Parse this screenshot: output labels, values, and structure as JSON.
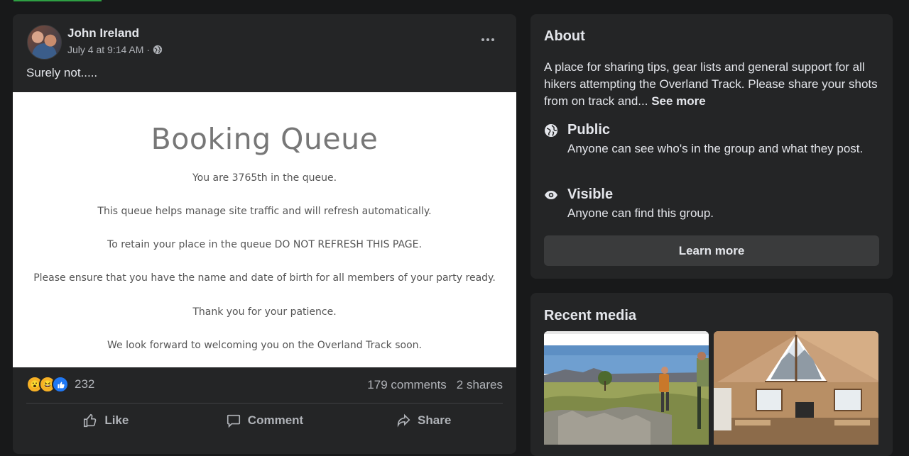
{
  "post": {
    "author": "John Ireland",
    "timestamp": "July 4 at 9:14 AM",
    "separator": "·",
    "audience_icon": "globe-icon",
    "text": "Surely not.....",
    "image": {
      "title": "Booking Queue",
      "lines": [
        "You are 3765th in the queue.",
        "This queue helps manage site traffic and will refresh automatically.",
        "To retain your place in the queue DO NOT REFRESH THIS PAGE.",
        "Please ensure that you have the name and date of birth for all members of your party ready.",
        "Thank you for your patience.",
        "We look forward to welcoming you on the Overland Track soon."
      ]
    },
    "reaction_count": "232",
    "reaction_icons": [
      "wow-icon",
      "haha-icon",
      "like-reaction-icon"
    ],
    "comments": "179 comments",
    "shares": "2 shares",
    "actions": {
      "like": "Like",
      "comment": "Comment",
      "share": "Share"
    }
  },
  "about": {
    "title": "About",
    "description": "A place for sharing tips, gear lists and general support for all hikers attempting the Overland Track. Please share your shots from on track and...",
    "see_more": "See more",
    "privacy": {
      "title": "Public",
      "subtitle": "Anyone can see who's in the group and what they post."
    },
    "visibility": {
      "title": "Visible",
      "subtitle": "Anyone can find this group."
    },
    "learn_more": "Learn more"
  },
  "recent_media": {
    "title": "Recent media"
  },
  "colors": {
    "background": "#18191a",
    "card": "#242526",
    "text_primary": "#e4e6eb",
    "text_secondary": "#b0b3b8",
    "button": "#3a3b3c",
    "like_blue": "#2078f4"
  }
}
